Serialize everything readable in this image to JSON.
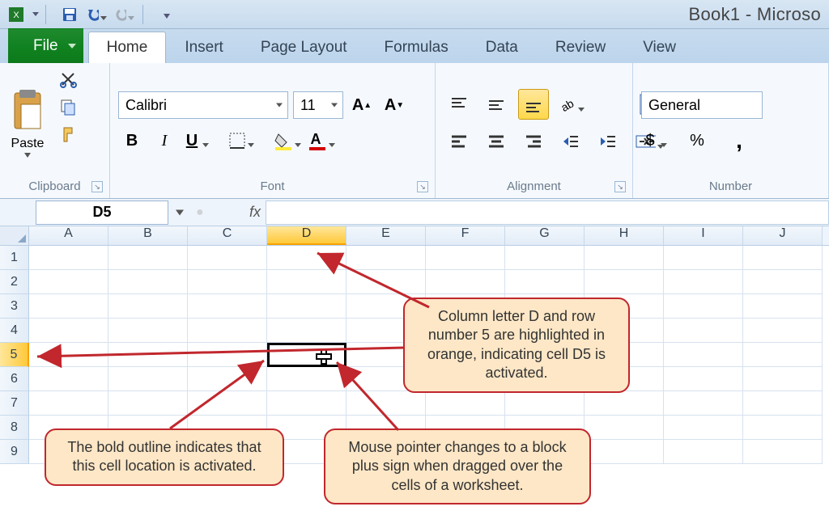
{
  "title": "Book1 - Microso",
  "qat_icons": [
    "excel-app-icon",
    "save-icon",
    "undo-icon",
    "redo-icon"
  ],
  "tabs": {
    "file": "File",
    "list": [
      "Home",
      "Insert",
      "Page Layout",
      "Formulas",
      "Data",
      "Review",
      "View"
    ],
    "active": "Home"
  },
  "ribbon": {
    "clipboard": {
      "paste": "Paste",
      "label": "Clipboard"
    },
    "font": {
      "name": "Calibri",
      "size": "11",
      "bold": "B",
      "italic": "I",
      "underline": "U",
      "label": "Font"
    },
    "alignment": {
      "label": "Alignment"
    },
    "number": {
      "format": "General",
      "currency": "$",
      "percent": "%",
      "comma": ",",
      "label": "Number"
    }
  },
  "name_box": "D5",
  "fx_label": "fx",
  "columns": [
    "A",
    "B",
    "C",
    "D",
    "E",
    "F",
    "G",
    "H",
    "I",
    "J"
  ],
  "active_col": "D",
  "rows": [
    1,
    2,
    3,
    4,
    5,
    6,
    7,
    8,
    9
  ],
  "active_row": 5,
  "callouts": {
    "c1": "Column letter D and row number 5 are highlighted in orange, indicating cell D5 is activated.",
    "c2": "The bold outline indicates that this cell location is activated.",
    "c3": "Mouse pointer changes to a block plus sign when dragged over the cells of a worksheet."
  }
}
